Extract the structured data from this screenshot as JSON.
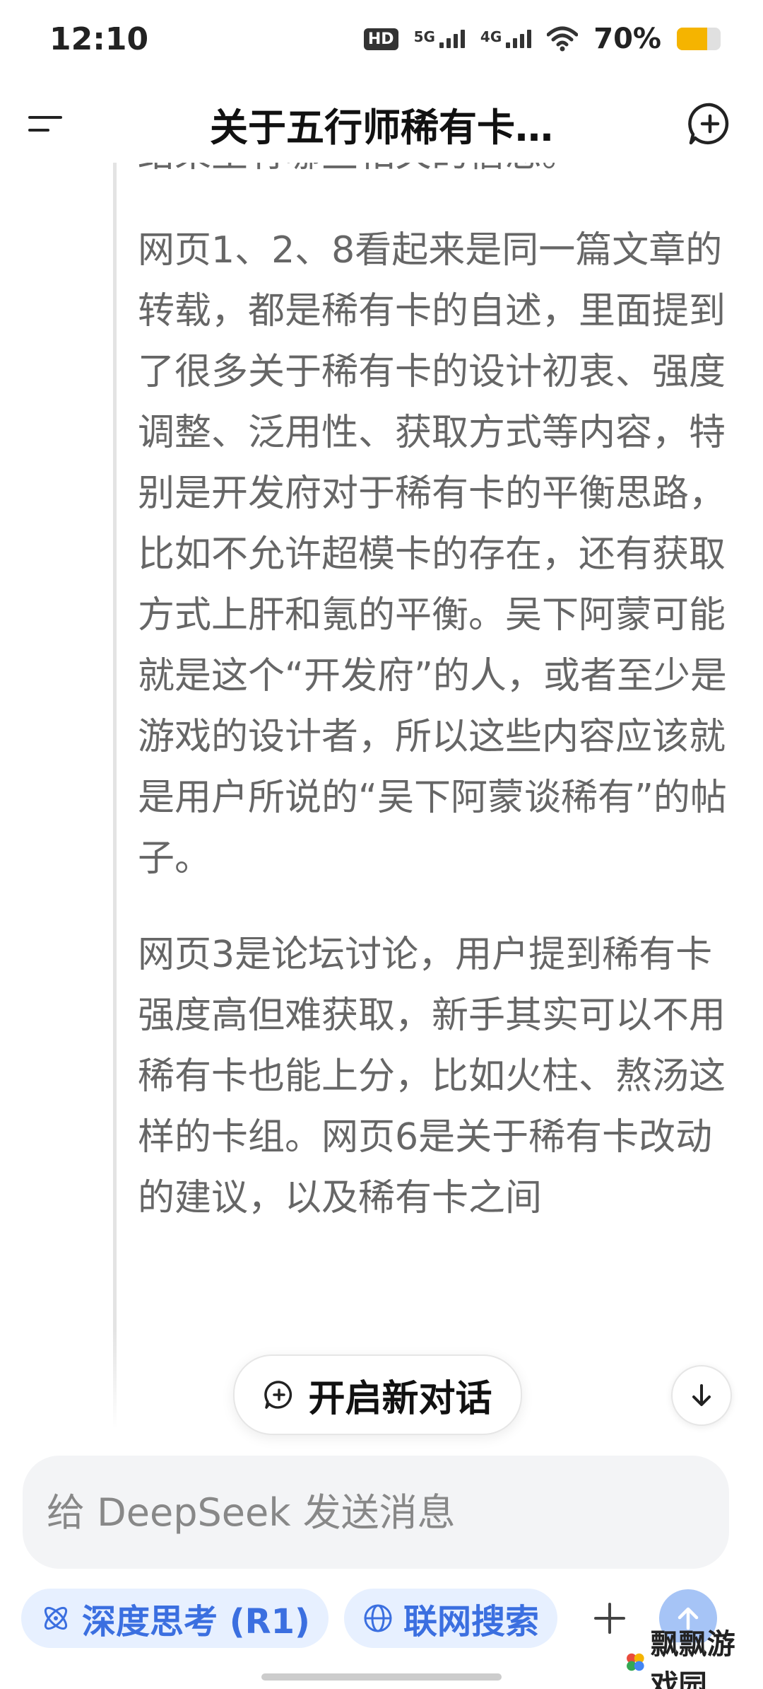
{
  "status_bar": {
    "time": "12:10",
    "hd_label": "HD",
    "sim1_label": "5G",
    "sim2_label": "4G",
    "battery_percent": "70%",
    "battery_level": 0.7
  },
  "header": {
    "title": "关于五行师稀有卡…"
  },
  "content": {
    "paragraphs": [
      "结果里有哪些相关的信息。",
      "网页1、2、8看起来是同一篇文章的转载，都是稀有卡的自述，里面提到了很多关于稀有卡的设计初衷、强度调整、泛用性、获取方式等内容，特别是开发府对于稀有卡的平衡思路，比如不允许超模卡的存在，还有获取方式上肝和氪的平衡。吴下阿蒙可能就是这个“开发府”的人，或者至少是游戏的设计者，所以这些内容应该就是用户所说的“吴下阿蒙谈稀有”的帖子。",
      "网页3是论坛讨论，用户提到稀有卡强度高但难获取，新手其实可以不用稀有卡也能上分，比如火柱、熬汤这样的卡组。网页6是关于稀有卡改动的建议，以及稀有卡之间"
    ]
  },
  "floating": {
    "new_chat_label": "开启新对话"
  },
  "input": {
    "placeholder": "给 DeepSeek 发送消息"
  },
  "toolbar": {
    "deep_think_label": "深度思考 (R1)",
    "web_search_label": "联网搜索"
  },
  "watermark": {
    "text": "飘飘游戏园"
  },
  "colors": {
    "accent": "#3b6fe0",
    "chip_bg": "#e7f0ff",
    "send_bg": "#a6c4f6",
    "battery": "#f5b400"
  }
}
